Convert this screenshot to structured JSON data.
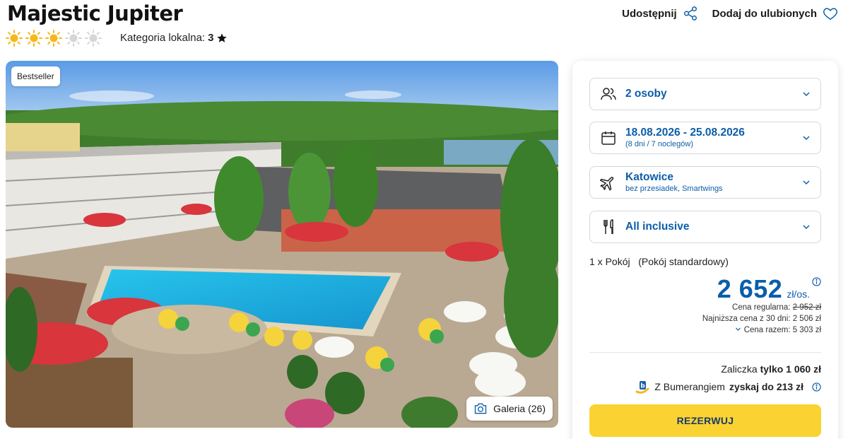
{
  "hotel": {
    "name": "Majestic Jupiter",
    "stars_filled": 3,
    "stars_total": 5,
    "local_category_label": "Kategoria lokalna:",
    "local_category_value": "3"
  },
  "actions": {
    "share_label": "Udostępnij",
    "favorite_label": "Dodaj do ulubionych"
  },
  "photo": {
    "badge": "Bestseller",
    "gallery_label": "Galeria (26)"
  },
  "booking": {
    "persons": {
      "main": "2 osoby",
      "icon": "users-icon"
    },
    "dates": {
      "main": "18.08.2026 - 25.08.2026",
      "sub": "(8 dni / 7 noclegów)",
      "icon": "calendar-icon"
    },
    "flight": {
      "main": "Katowice",
      "sub": "bez przesiadek, Smartwings",
      "icon": "plane-icon"
    },
    "board": {
      "main": "All inclusive",
      "icon": "cutlery-icon"
    },
    "room": "1 x Pokój   (Pokój standardowy)",
    "price_value": "2 652",
    "price_unit": "zł/os.",
    "regular_price_label": "Cena regularna:",
    "regular_price_value": "2 952 zł",
    "lowest_price_text": "Najniższa cena z 30 dni: 2 506 zł",
    "total_price_text": "Cena razem: 5 303 zł",
    "deposit_label": "Zaliczka",
    "deposit_value": "tylko 1 060 zł",
    "bumerang_label": "Z Bumerangiem",
    "bumerang_value": "zyskaj do 213 zł",
    "reserve_label": "REZERWUJ"
  },
  "colors": {
    "accent_blue": "#0b5ea8",
    "reserve_yellow": "#fad332",
    "star_gold": "#f5b81c",
    "star_grey": "#d6d6d6"
  }
}
